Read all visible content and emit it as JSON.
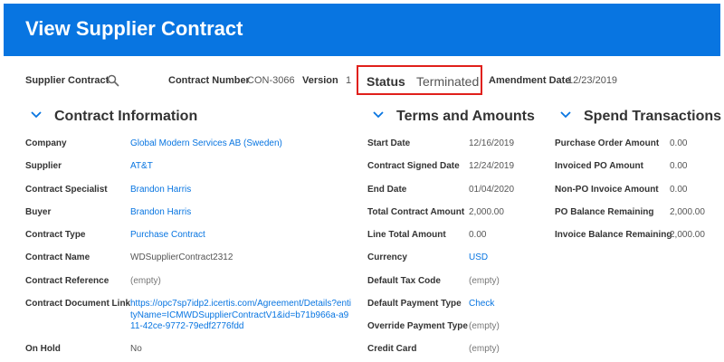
{
  "header": {
    "title": "View Supplier Contract"
  },
  "topbar": {
    "supplier_contract_label": "Supplier Contract",
    "contract_number_label": "Contract Number",
    "contract_number": "CON-3066",
    "version_label": "Version",
    "version": "1",
    "status_label": "Status",
    "status": "Terminated",
    "amendment_date_label": "Amendment Date",
    "amendment_date": "12/23/2019",
    "icon": "search-icon"
  },
  "contract_information": {
    "title": "Contract Information",
    "rows": [
      {
        "label": "Company",
        "value": "Global Modern Services AB (Sweden)"
      },
      {
        "label": "Supplier",
        "value": "AT&T"
      },
      {
        "label": "Contract Specialist",
        "value": "Brandon Harris"
      },
      {
        "label": "Buyer",
        "value": "Brandon Harris"
      },
      {
        "label": "Contract Type",
        "value": "Purchase Contract"
      },
      {
        "label": "Contract Name",
        "value": "WDSupplierContract2312"
      },
      {
        "label": "Contract Reference",
        "value": "(empty)"
      },
      {
        "label": "Contract Document Link",
        "value": "https://opc7sp7idp2.icertis.com/Agreement/Details?entityName=ICMWDSupplierContractV1&id=b71b966a-a911-42ce-9772-79edf2776fdd"
      },
      {
        "label": "On Hold",
        "value": "No"
      }
    ]
  },
  "terms_and_amounts": {
    "title": "Terms and Amounts",
    "rows": [
      {
        "label": "Start Date",
        "value": "12/16/2019"
      },
      {
        "label": "Contract Signed Date",
        "value": "12/24/2019"
      },
      {
        "label": "End Date",
        "value": "01/04/2020"
      },
      {
        "label": "Total Contract Amount",
        "value": "2,000.00"
      },
      {
        "label": "Line Total Amount",
        "value": "0.00"
      },
      {
        "label": "Currency",
        "value": "USD"
      },
      {
        "label": "Default Tax Code",
        "value": "(empty)"
      },
      {
        "label": "Default Payment Type",
        "value": "Check"
      },
      {
        "label": "Override Payment Type",
        "value": "(empty)"
      },
      {
        "label": "Credit Card",
        "value": "(empty)"
      }
    ]
  },
  "spend_transactions": {
    "title": "Spend Transactions",
    "rows": [
      {
        "label": "Purchase Order Amount",
        "value": "0.00"
      },
      {
        "label": "Invoiced PO Amount",
        "value": "0.00"
      },
      {
        "label": "Non-PO Invoice Amount",
        "value": "0.00"
      },
      {
        "label": "PO Balance Remaining",
        "value": "2,000.00"
      },
      {
        "label": "Invoice Balance Remaining",
        "value": "2,000.00"
      }
    ]
  },
  "colors": {
    "header": "#0875e1",
    "link": "#0875e1",
    "highlight": "#e0201b"
  }
}
